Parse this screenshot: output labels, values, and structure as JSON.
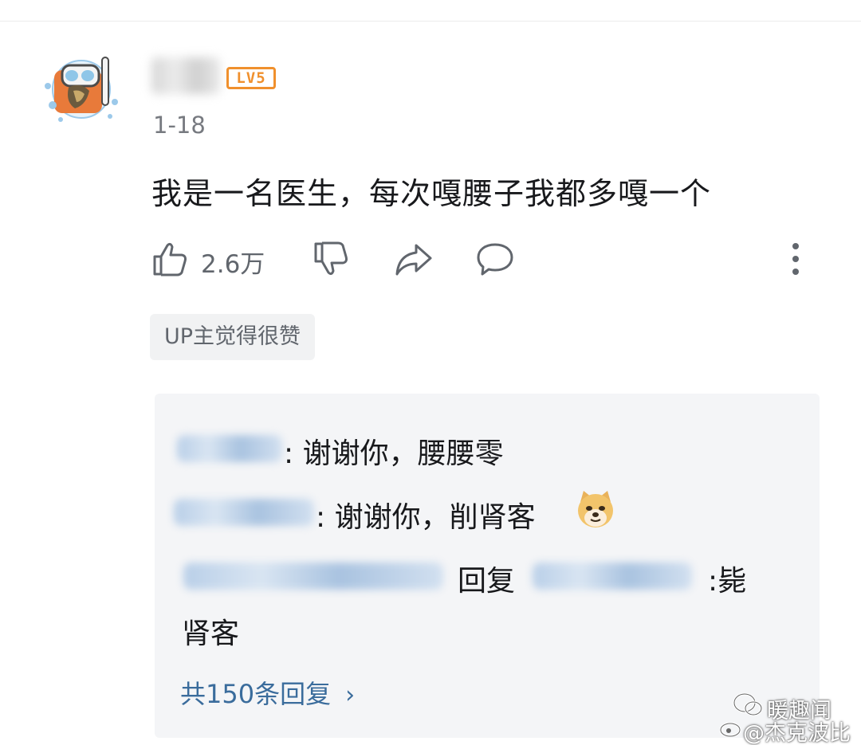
{
  "comment": {
    "level_badge": "LV5",
    "date": "1-18",
    "text": "我是一名医生，每次嘎腰子我都多嘎一个",
    "like_count": "2.6万",
    "up_tag": "UP主觉得很赞"
  },
  "replies": {
    "items": [
      {
        "text": ": 谢谢你，腰腰零"
      },
      {
        "text": ": 谢谢你，削肾客"
      },
      {
        "reply_word": "回复",
        "text": ":毙"
      }
    ],
    "wrapped_text": "肾客",
    "more_label": "共150条回复",
    "more_chevron": "›"
  },
  "watermark": {
    "line1": "暖趣闻",
    "line2": "@杰克波比"
  },
  "colors": {
    "level_badge": "#f0902d",
    "link": "#3a6c9c",
    "secondary_text": "#61666d"
  },
  "icons": {
    "avatar": "avatar-icon",
    "like": "thumb-up-icon",
    "dislike": "thumb-down-icon",
    "share": "share-icon",
    "reply": "comment-bubble-icon",
    "more": "more-vertical-icon",
    "emoji": "doge-emoji-icon"
  }
}
